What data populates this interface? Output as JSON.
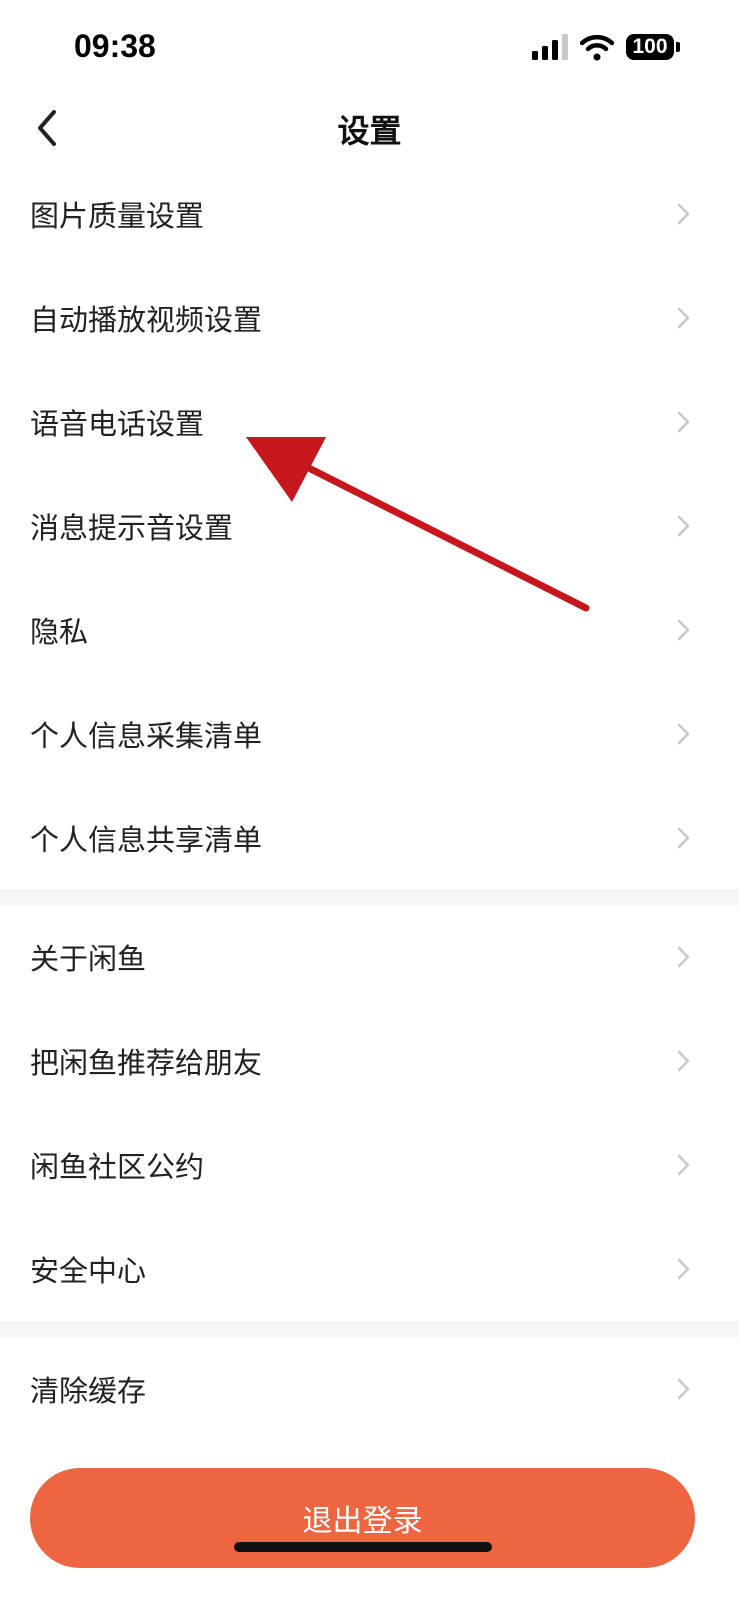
{
  "status_bar": {
    "time": "09:38",
    "battery": "100",
    "icons": [
      "cellular-signal-icon",
      "wifi-icon",
      "battery-icon"
    ]
  },
  "nav": {
    "title": "设置",
    "back_icon": "chevron-left-icon"
  },
  "section1": {
    "items": [
      {
        "label": "图片质量设置"
      },
      {
        "label": "自动播放视频设置"
      },
      {
        "label": "语音电话设置"
      },
      {
        "label": "消息提示音设置"
      },
      {
        "label": "隐私"
      },
      {
        "label": "个人信息采集清单"
      },
      {
        "label": "个人信息共享清单"
      }
    ]
  },
  "section2": {
    "items": [
      {
        "label": "关于闲鱼"
      },
      {
        "label": "把闲鱼推荐给朋友"
      },
      {
        "label": "闲鱼社区公约"
      },
      {
        "label": "安全中心"
      }
    ]
  },
  "section3": {
    "items": [
      {
        "label": "清除缓存"
      }
    ]
  },
  "logout": {
    "label": "退出登录"
  },
  "colors": {
    "accent": "#ee6641",
    "annotation_arrow": "#c8161d",
    "divider": "#f5f5f5",
    "chevron": "#c8c8c8"
  }
}
